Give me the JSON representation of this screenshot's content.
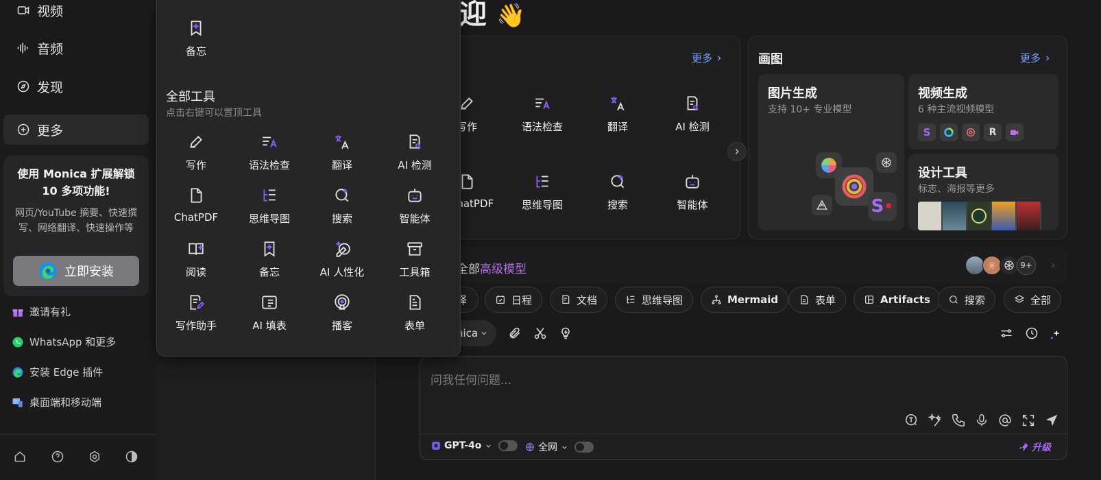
{
  "sidebar": {
    "nav": [
      {
        "label": "视频",
        "icon": "video-icon"
      },
      {
        "label": "音频",
        "icon": "audio-icon"
      },
      {
        "label": "发现",
        "icon": "compass-icon"
      },
      {
        "label": "更多",
        "icon": "plus-circle-icon"
      }
    ],
    "promo": {
      "title": "使用 Monica 扩展解锁 10 多项功能!",
      "desc": "网页/YouTube 摘要、快速撰写、网络翻译、快速操作等",
      "button": "立即安装"
    },
    "links": [
      {
        "label": "邀请有礼"
      },
      {
        "label": "WhatsApp 和更多"
      },
      {
        "label": "安装 Edge 插件"
      },
      {
        "label": "桌面端和移动端"
      }
    ]
  },
  "dropdown": {
    "pinned_label": "备忘",
    "all_tools_title": "全部工具",
    "all_tools_sub": "点击右键可以置顶工具",
    "tools": [
      "写作",
      "语法检查",
      "翻译",
      "AI 检测",
      "ChatPDF",
      "思维导图",
      "搜索",
      "智能体",
      "阅读",
      "备忘",
      "AI 人性化",
      "工具箱",
      "写作助手",
      "AI 填表",
      "播客",
      "表单"
    ]
  },
  "main": {
    "greeting_tail": "迎",
    "greeting_emoji": "👋",
    "tools_card": {
      "more": "更多",
      "items": [
        "写作",
        "语法检查",
        "翻译",
        "AI 检测",
        "ChatPDF",
        "思维导图",
        "搜索",
        "智能体"
      ]
    },
    "draw_card": {
      "title": "画图",
      "more": "更多",
      "image_gen": {
        "title": "图片生成",
        "sub": "支持 10+ 专业模型"
      },
      "video_gen": {
        "title": "视频生成",
        "sub": "6 种主流视频模型"
      },
      "design": {
        "title": "设计工具",
        "sub": "标志、海报等更多"
      }
    },
    "models_bar": {
      "prefix": "全部",
      "highlight": "高级模型",
      "badge": "9+"
    },
    "chips": [
      "译",
      "日程",
      "文档",
      "思维导图",
      "Mermaid",
      "表单",
      "Artifacts",
      "搜索",
      "全部"
    ],
    "model_selector": "nica",
    "input_placeholder": "问我任何问题...",
    "footer": {
      "model": "GPT-4o",
      "web": "全网",
      "upgrade": "升级"
    }
  },
  "colors": {
    "accent": "#7aa2ff",
    "purple": "#8b5cf6",
    "bg": "#1a1a1b"
  }
}
